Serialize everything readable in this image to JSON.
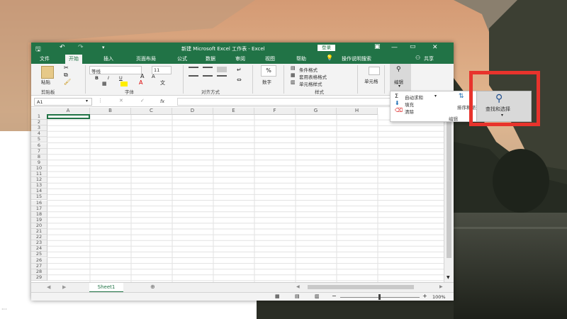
{
  "window": {
    "title": "新建 Microsoft Excel 工作表 - Excel",
    "login_label": "登录",
    "minimize_glyph": "—",
    "restore_glyph": "▭",
    "close_glyph": "✕",
    "save_icon": "save-icon",
    "undo_glyph": "↶",
    "redo_glyph": "↷"
  },
  "tabs": [
    {
      "label": "文件"
    },
    {
      "label": "开始"
    },
    {
      "label": "插入"
    },
    {
      "label": "页面布局"
    },
    {
      "label": "公式"
    },
    {
      "label": "数据"
    },
    {
      "label": "审阅"
    },
    {
      "label": "视图"
    },
    {
      "label": "帮助"
    }
  ],
  "tell_me": "操作说明搜索",
  "share": "共享",
  "ribbon": {
    "paste": "粘贴",
    "clipboard": "剪贴板",
    "font_name": "等线",
    "font_size": "11",
    "bold": "B",
    "italic": "I",
    "underline": "U",
    "font_group": "字体",
    "align_group": "对齐方式",
    "number_label": "数字",
    "percent": "%",
    "cond_format": "条件格式",
    "table_format": "套用表格格式",
    "cell_style": "单元格样式",
    "styles_group": "样式",
    "cells_label": "单元格",
    "edit_label": "编辑"
  },
  "formula_bar": {
    "name_box": "A1",
    "fx": "fx"
  },
  "columns": [
    "A",
    "B",
    "C",
    "D",
    "E",
    "F",
    "G",
    "H"
  ],
  "rows": [
    "1",
    "2",
    "3",
    "4",
    "5",
    "6",
    "7",
    "8",
    "9",
    "10",
    "11",
    "12",
    "13",
    "14",
    "15",
    "16",
    "17",
    "18",
    "19",
    "20",
    "21",
    "22",
    "23",
    "24",
    "25",
    "26",
    "27",
    "28",
    "29"
  ],
  "sheet_tab": "Sheet1",
  "zoom": "100%",
  "dropdown": {
    "autosum": "自动求和",
    "fill": "填充",
    "clear": "清除",
    "sort_filter": "排序和筛选",
    "find_select": "查找和选择",
    "group_label": "编辑"
  },
  "colors": {
    "excel_green": "#217346",
    "highlight_red": "#e8332c"
  }
}
